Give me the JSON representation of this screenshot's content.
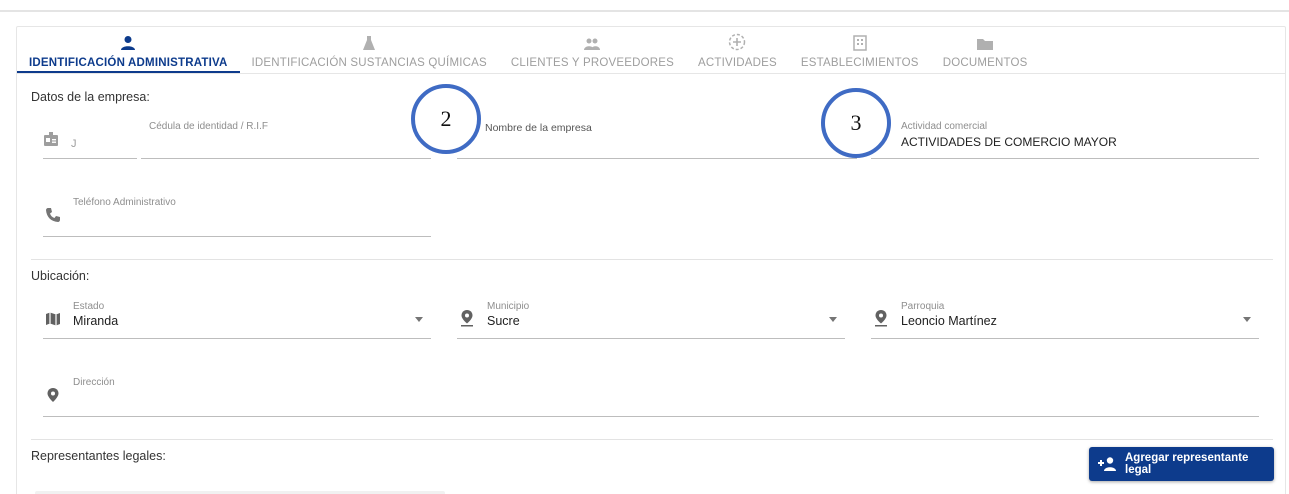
{
  "tabs": [
    {
      "label": "IDENTIFICACIÓN ADMINISTRATIVA",
      "icon": "person-icon",
      "active": true
    },
    {
      "label": "IDENTIFICACIÓN SUSTANCIAS QUÍMICAS",
      "icon": "flask-icon",
      "active": false
    },
    {
      "label": "CLIENTES Y PROVEEDORES",
      "icon": "people-icon",
      "active": false
    },
    {
      "label": "ACTIVIDADES",
      "icon": "activity-icon",
      "active": false
    },
    {
      "label": "ESTABLECIMIENTOS",
      "icon": "building-icon",
      "active": false
    },
    {
      "label": "DOCUMENTOS",
      "icon": "folder-icon",
      "active": false
    }
  ],
  "empresa": {
    "section_title": "Datos de la empresa:",
    "rif_prefix": "J",
    "cedula_label": "Cédula de identidad / R.I.F",
    "cedula_value": "",
    "nombre_label": "Nombre de la empresa",
    "nombre_value": "",
    "actividad_label": "Actividad comercial",
    "actividad_value": "ACTIVIDADES DE COMERCIO MAYOR",
    "telefono_label": "Teléfono Administrativo",
    "telefono_value": ""
  },
  "ubicacion": {
    "section_title": "Ubicación:",
    "estado_label": "Estado",
    "estado_value": "Miranda",
    "municipio_label": "Municipio",
    "municipio_value": "Sucre",
    "parroquia_label": "Parroquia",
    "parroquia_value": "Leoncio Martínez",
    "direccion_label": "Dirección",
    "direccion_value": ""
  },
  "representantes": {
    "section_title": "Representantes legales:",
    "add_button_label": "Agregar representante legal"
  },
  "annotations": {
    "marker_2": "2",
    "marker_3": "3"
  },
  "colors": {
    "primary": "#0d3b8c",
    "annotation_ring": "#3f6bc4",
    "inactive_tab": "#9e9e9e"
  }
}
